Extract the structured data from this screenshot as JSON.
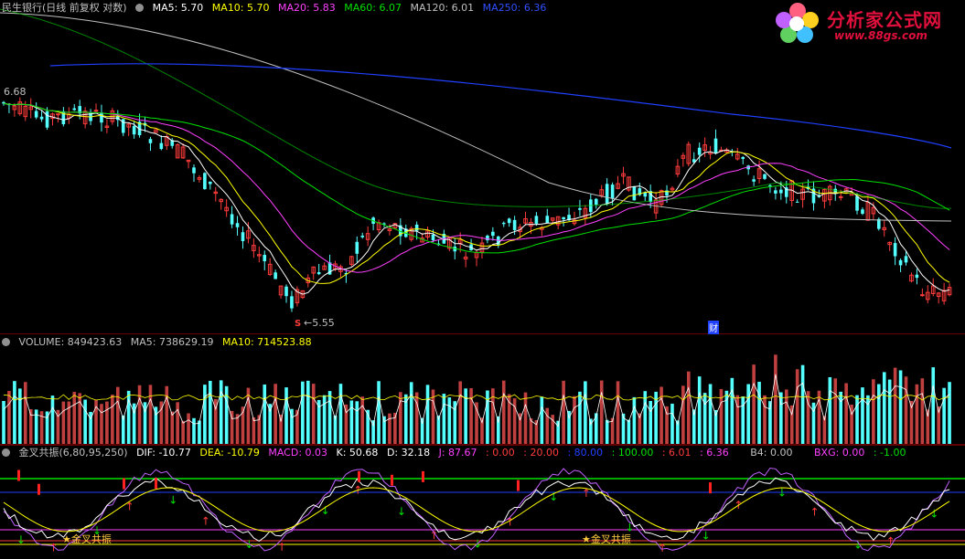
{
  "main_header": {
    "title": "民生银行(日线 前复权 对数)",
    "ma5": "MA5: 5.70",
    "ma10": "MA10: 5.70",
    "ma20": "MA20: 5.83",
    "ma60": "MA60: 6.07",
    "ma120": "MA120: 6.01",
    "ma250": "MA250: 6.36"
  },
  "main_chart": {
    "high_label": "6.68",
    "low_label": "5.55",
    "event_label": "财",
    "sell_marker": "S"
  },
  "volume_header": {
    "title": "VOLUME: 849423.63",
    "ma5": "MA5: 738629.19",
    "ma10": "MA10: 714523.88"
  },
  "indicator_header": {
    "title": "金叉共振(6,80,95,250)",
    "dif": "DIF: -10.77",
    "dea": "DEA: -10.79",
    "macd": "MACD: 0.03",
    "k": "K: 50.68",
    "d": "D: 32.18",
    "j": "J: 87.67",
    "v1": ": 0.00",
    "v2": ": 20.00",
    "v3": ": 80.00",
    "v4": ": 100.00",
    "v5": ": 6.01",
    "v6": ": 6.36",
    "b4": "B4: 0.00",
    "bxg": "BXG: 0.00",
    "v7": ": -1.00"
  },
  "indicator_labels": {
    "gold_cross_1": "金叉共振",
    "gold_cross_2": "金叉共振"
  },
  "logo": {
    "main": "分析家公式网",
    "sub": "www.88gs.com"
  },
  "colors": {
    "up": "#ff3c3c",
    "down": "#54ffff",
    "ma5": "#ffffff",
    "ma10": "#ffff00",
    "ma20": "#ff40ff",
    "ma60": "#00e000",
    "ma120": "#c0c0c0",
    "ma250": "#2040ff",
    "panel_border": "#c00000"
  }
}
